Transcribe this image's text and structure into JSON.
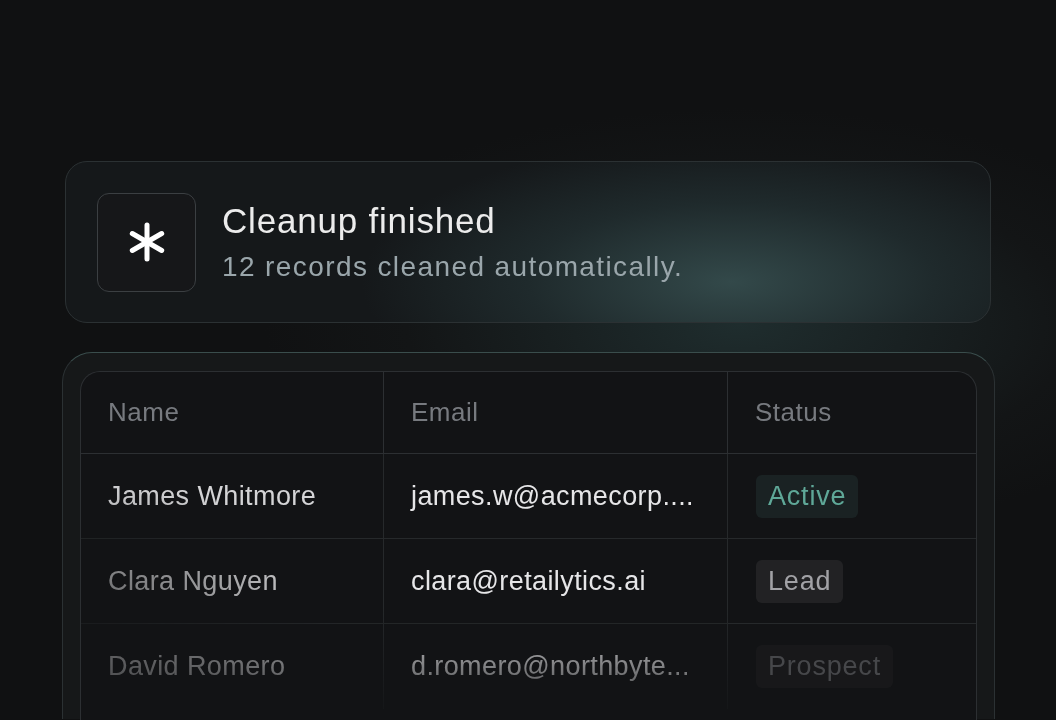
{
  "notification": {
    "title": "Cleanup finished",
    "message": "12 records cleaned automatically."
  },
  "table": {
    "columns": [
      "Name",
      "Email",
      "Status"
    ],
    "rows": [
      {
        "name": "James Whitmore",
        "email": "james.w@acmecorp....",
        "status": {
          "label": "Active",
          "color": "#5fa898"
        }
      },
      {
        "name": "Clara Nguyen",
        "email": "clara@retailytics.ai",
        "status": {
          "label": "Lead",
          "color": "#a2a2a6"
        }
      },
      {
        "name": "David Romero",
        "email": "d.romero@northbyte...",
        "status": {
          "label": "Prospect",
          "color": "#46474a"
        }
      }
    ]
  }
}
